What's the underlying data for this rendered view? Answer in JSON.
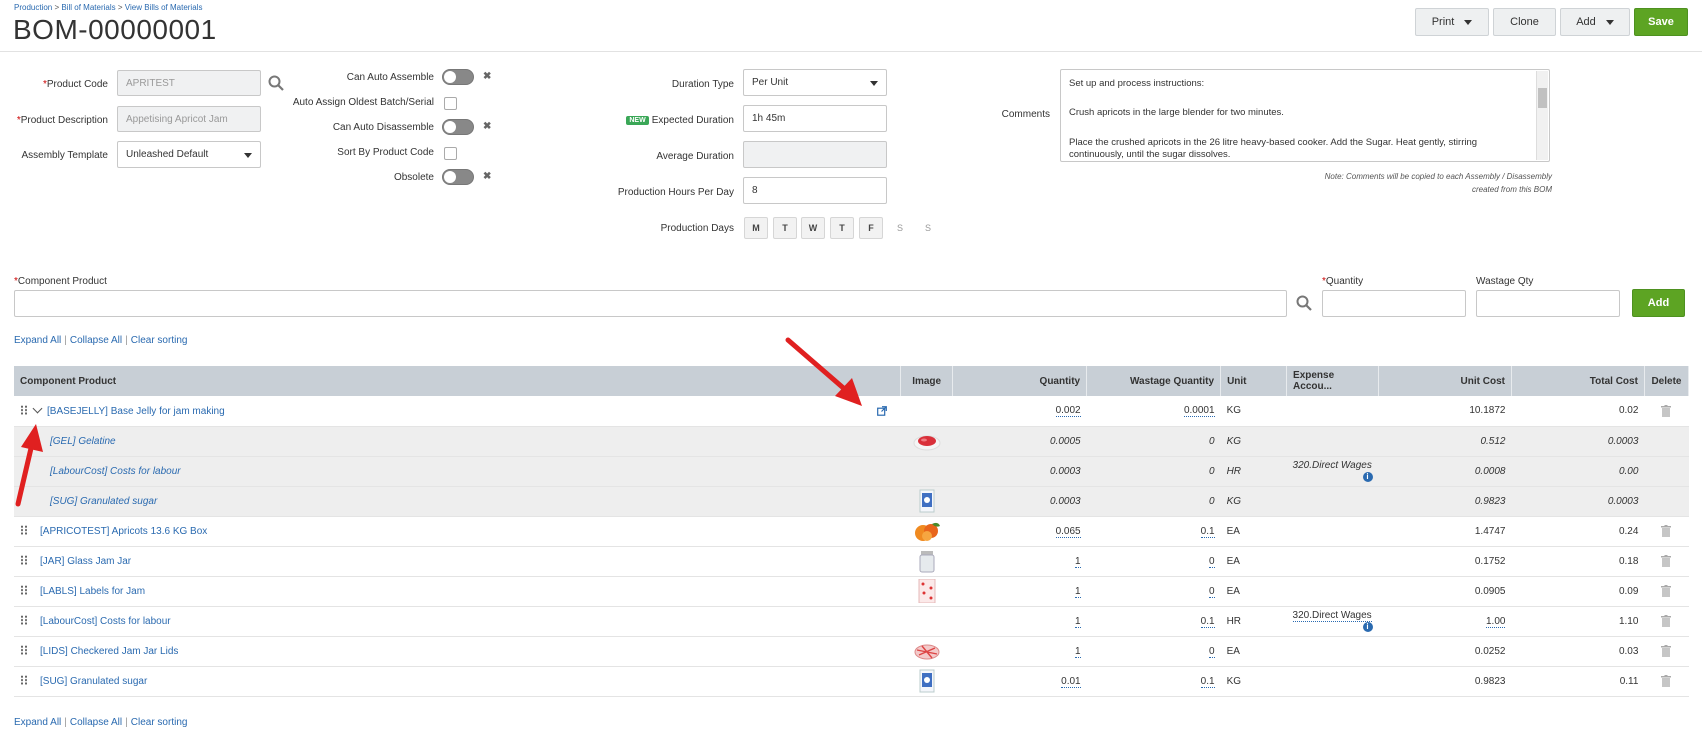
{
  "breadcrumb": {
    "production": "Production",
    "bills": "Bill of Materials",
    "view": "View Bills of Materials",
    "sep": ">"
  },
  "page_title": "BOM-00000001",
  "actions": {
    "print": "Print",
    "clone": "Clone",
    "add": "Add",
    "save": "Save"
  },
  "form": {
    "product_code_label": "Product Code",
    "product_code": "APRITEST",
    "product_desc_label": "Product Description",
    "product_desc": "Appetising Apricot Jam",
    "assembly_template_label": "Assembly Template",
    "assembly_template": "Unleashed Default",
    "can_auto_assemble": "Can Auto Assemble",
    "auto_assign_batch": "Auto Assign Oldest Batch/Serial",
    "can_auto_disassemble": "Can Auto Disassemble",
    "sort_by_code": "Sort By Product Code",
    "obsolete": "Obsolete",
    "duration_type_label": "Duration Type",
    "duration_type": "Per Unit",
    "new_badge": "NEW",
    "expected_duration_label": "Expected Duration",
    "expected_duration": "1h 45m",
    "average_duration_label": "Average Duration",
    "average_duration": "",
    "hours_per_day_label": "Production Hours Per Day",
    "hours_per_day": "8",
    "production_days_label": "Production Days",
    "days": [
      "M",
      "T",
      "W",
      "T",
      "F",
      "S",
      "S"
    ],
    "comments_label": "Comments",
    "comments": [
      "Set up and process instructions:",
      "Crush apricots in the large blender for two minutes.",
      "Place the crushed apricots in the 26 litre heavy-based cooker. Add the Sugar. Heat gently, stirring continuously, until the sugar dissolves."
    ],
    "note_line1": "Note: Comments will be copied to each Assembly / Disassembly",
    "note_line2": "created from this BOM"
  },
  "component": {
    "product_label": "Component Product",
    "quantity_label": "Quantity",
    "wastage_label": "Wastage Qty",
    "add": "Add"
  },
  "links": {
    "expand": "Expand All",
    "collapse": "Collapse All",
    "clear": "Clear sorting"
  },
  "table": {
    "headers": [
      "Component Product",
      "Image",
      "Quantity",
      "Wastage Quantity",
      "Unit",
      "Expense Accou...",
      "Unit Cost",
      "Total Cost",
      "Delete"
    ],
    "rows": [
      {
        "product": "[BASEJELLY] Base Jelly for jam making",
        "qty": "0.002",
        "wastage": "0.0001",
        "unit": "KG",
        "expense": "",
        "unit_cost": "10.1872",
        "total": "0.02",
        "image": ""
      },
      {
        "product": "[GEL] Gelatine",
        "qty": "0.0005",
        "wastage": "0",
        "unit": "KG",
        "expense": "",
        "unit_cost": "0.512",
        "total": "0.0003",
        "image": "gelatine"
      },
      {
        "product": "[LabourCost] Costs for labour",
        "qty": "0.0003",
        "wastage": "0",
        "unit": "HR",
        "expense": "320.Direct Wages",
        "unit_cost": "0.0008",
        "total": "0.00",
        "image": ""
      },
      {
        "product": "[SUG] Granulated sugar",
        "qty": "0.0003",
        "wastage": "0",
        "unit": "KG",
        "expense": "",
        "unit_cost": "0.9823",
        "total": "0.0003",
        "image": "sugar"
      },
      {
        "product": "[APRICOTEST] Apricots 13.6 KG Box",
        "qty": "0.065",
        "wastage": "0.1",
        "unit": "EA",
        "expense": "",
        "unit_cost": "1.4747",
        "total": "0.24",
        "image": "apricot"
      },
      {
        "product": "[JAR] Glass Jam Jar",
        "qty": "1",
        "wastage": "0",
        "unit": "EA",
        "expense": "",
        "unit_cost": "0.1752",
        "total": "0.18",
        "image": "jar"
      },
      {
        "product": "[LABLS] Labels for Jam",
        "qty": "1",
        "wastage": "0",
        "unit": "EA",
        "expense": "",
        "unit_cost": "0.0905",
        "total": "0.09",
        "image": "labels"
      },
      {
        "product": "[LabourCost] Costs for labour",
        "qty": "1",
        "wastage": "0.1",
        "unit": "HR",
        "expense": "320.Direct Wages",
        "unit_cost": "1.00",
        "total": "1.10",
        "image": ""
      },
      {
        "product": "[LIDS] Checkered Jam Jar Lids",
        "qty": "1",
        "wastage": "0",
        "unit": "EA",
        "expense": "",
        "unit_cost": "0.0252",
        "total": "0.03",
        "image": "lids"
      },
      {
        "product": "[SUG] Granulated sugar",
        "qty": "0.01",
        "wastage": "0.1",
        "unit": "KG",
        "expense": "",
        "unit_cost": "0.9823",
        "total": "0.11",
        "image": "sugar"
      }
    ]
  },
  "colors": {
    "accent": "#5da423",
    "link": "#2a6ab0",
    "header_bg": "#c8cfd6",
    "arrow": "#e02020"
  }
}
